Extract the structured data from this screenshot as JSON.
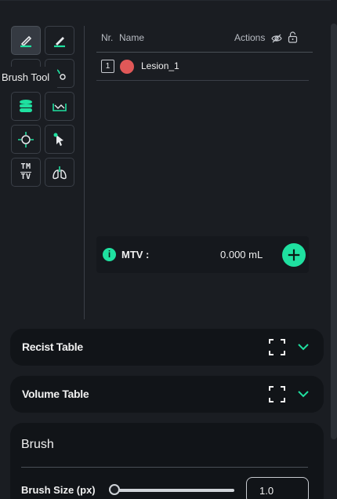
{
  "tooltip": {
    "text": "Brush Tool"
  },
  "tools": [
    {
      "name": "brush-tool-icon"
    },
    {
      "name": "pen-tool-icon"
    },
    {
      "name": "threshold-tool-icon"
    },
    {
      "name": "circle-tool-icon"
    },
    {
      "name": "database-tool-icon"
    },
    {
      "name": "interpolate-tool-icon"
    },
    {
      "name": "crosshair-tool-icon"
    },
    {
      "name": "select-pointer-icon"
    },
    {
      "name": "tmtv-tool",
      "label_top": "TM",
      "label_bottom": "TV"
    },
    {
      "name": "lungs-tool-icon"
    }
  ],
  "segment_table": {
    "headers": {
      "nr": "Nr.",
      "name": "Name",
      "actions": "Actions"
    },
    "rows": [
      {
        "nr": "1",
        "name": "Lesion_1",
        "color": "#e05858"
      }
    ]
  },
  "mtv": {
    "label": "MTV :",
    "value": "0.000 mL"
  },
  "accordions": [
    {
      "title": "Recist Table"
    },
    {
      "title": "Volume Table"
    }
  ],
  "brush": {
    "title": "Brush",
    "size_label": "Brush Size (px)",
    "size_value": "1.0",
    "size_fraction": 0.0
  },
  "colors": {
    "accent": "#1fe0a0",
    "panel": "#1a1d22",
    "dark": "#111418"
  }
}
